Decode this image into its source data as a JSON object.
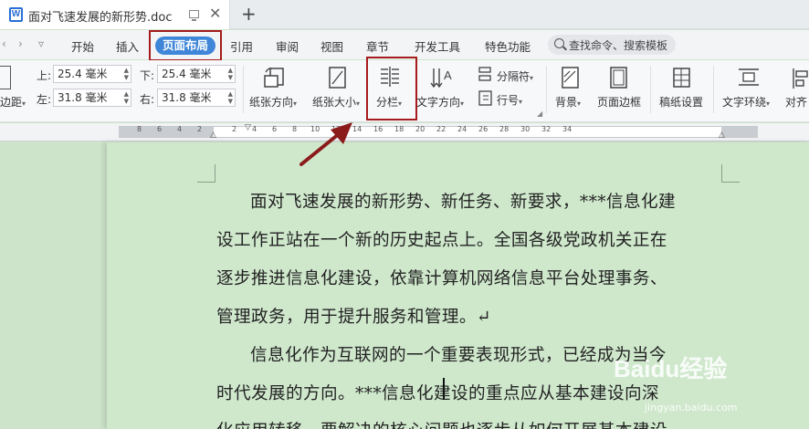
{
  "window": {
    "doc_title": "面对飞速发展的新形势.doc",
    "doc_icon_letter": "W"
  },
  "ribbon": {
    "tabs": [
      "开始",
      "插入",
      "页面布局",
      "引用",
      "审阅",
      "视图",
      "章节",
      "开发工具",
      "特色功能"
    ],
    "active_tab": "页面布局",
    "search_placeholder": "查找命令、搜索模板"
  },
  "margins": {
    "top_label": "上:",
    "top_value": "25.4 毫米",
    "bottom_label": "下:",
    "bottom_value": "25.4 毫米",
    "left_label": "左:",
    "left_value": "31.8 毫米",
    "right_label": "右:",
    "right_value": "31.8 毫米",
    "partial_label": "边距"
  },
  "toolbar": {
    "orientation": "纸张方向",
    "size": "纸张大小",
    "columns": "分栏",
    "text_direction": "文字方向",
    "separator": "分隔符",
    "line_number": "行号",
    "background": "背景",
    "page_border": "页面边框",
    "draft_settings": "稿纸设置",
    "text_wrap": "文字环绕",
    "align": "对齐"
  },
  "ruler": {
    "ticks": [
      "8",
      "6",
      "4",
      "2",
      "2",
      "4",
      "6",
      "8",
      "10",
      "12",
      "14",
      "16",
      "18",
      "20",
      "22",
      "24",
      "26",
      "28",
      "30",
      "32",
      "34"
    ]
  },
  "document": {
    "lines": [
      "面对飞速发展的新形势、新任务、新要求，***信息化建",
      "设工作正站在一个新的历史起点上。全国各级党政机关正在",
      "逐步推进信息化建设，依靠计算机网络信息平台处理事务、",
      "管理政务，用于提升服务和管理。↵",
      "信息化作为互联网的一个重要表现形式，已经成为当今",
      "时代发展的方向。***信息化建设的重点应从基本建设向深",
      "化应用转移，要解决的核心问题也逐步从如何开展基本建设"
    ]
  },
  "watermark": {
    "brand": "Baidu经验",
    "url": "jingyan.baidu.com"
  },
  "colors": {
    "accent": "#3f86d8",
    "highlight_box": "#a51c1c",
    "page_bg": "#cfe8cc"
  }
}
